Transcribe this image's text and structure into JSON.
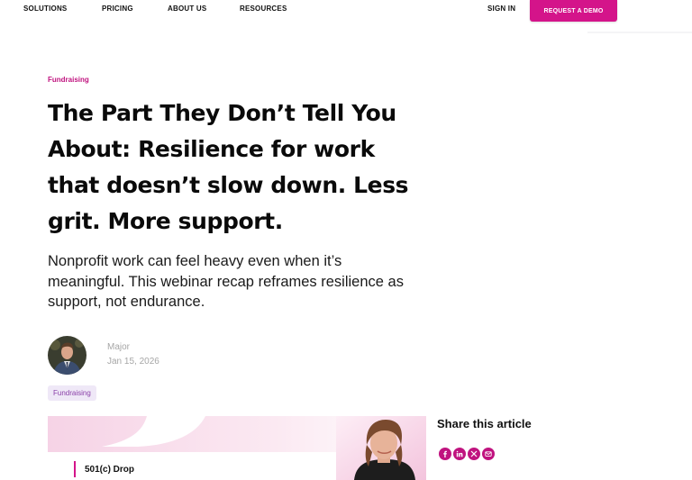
{
  "nav": {
    "items": [
      "SOLUTIONS",
      "PRICING",
      "ABOUT US",
      "RESOURCES"
    ],
    "sign_in": "SIGN IN",
    "cta": "REQUEST A DEMO"
  },
  "article": {
    "category": "Fundraising",
    "title": "The Part They Don’t Tell You About: Resilience for work that doesn’t slow down. Less grit. More support.",
    "lede": "Nonprofit work can feel heavy even when it’s meaningful. This webinar recap reframes resilience as support, not endurance.",
    "author": {
      "name": "Major",
      "date": "Jan 15, 2026"
    },
    "tag": "Fundraising"
  },
  "hero": {
    "brand": "501(c) Drop"
  },
  "share": {
    "title": "Share this article",
    "icons": [
      "facebook-icon",
      "linkedin-icon",
      "x-icon",
      "email-icon"
    ]
  },
  "colors": {
    "accent": "#d4148a",
    "tag_bg": "#efe8f7",
    "tag_text": "#8a3fa8"
  }
}
